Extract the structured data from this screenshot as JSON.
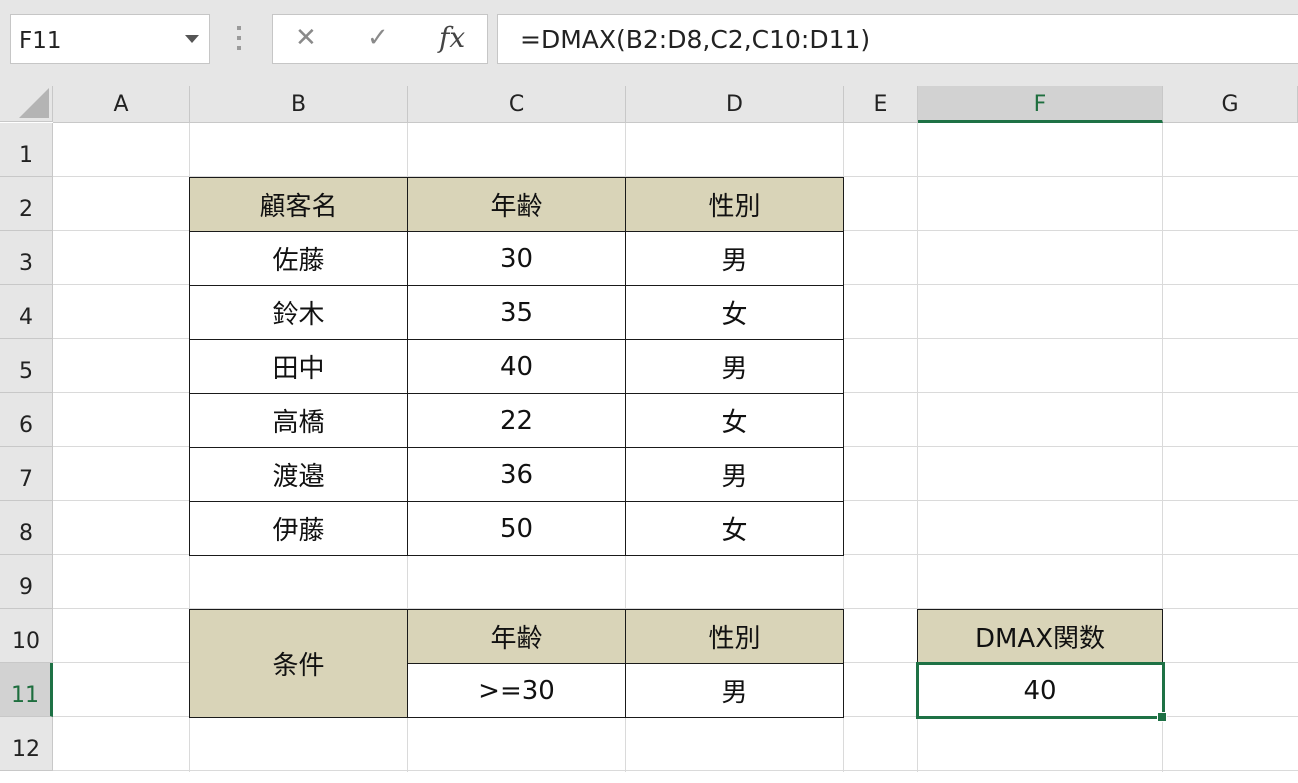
{
  "formula_bar": {
    "name_box": "F11",
    "cancel_symbol": "✕",
    "enter_symbol": "✓",
    "fx_label": "fx",
    "formula": "=DMAX(B2:D8,C2,C10:D11)"
  },
  "columns": [
    "A",
    "B",
    "C",
    "D",
    "E",
    "F",
    "G"
  ],
  "rows": [
    "1",
    "2",
    "3",
    "4",
    "5",
    "6",
    "7",
    "8",
    "9",
    "10",
    "11",
    "12"
  ],
  "selected": {
    "column": "F",
    "row": "11"
  },
  "table": {
    "headers": [
      "顧客名",
      "年齢",
      "性別"
    ],
    "rows": [
      [
        "佐藤",
        "30",
        "男"
      ],
      [
        "鈴木",
        "35",
        "女"
      ],
      [
        "田中",
        "40",
        "男"
      ],
      [
        "高橋",
        "22",
        "女"
      ],
      [
        "渡邉",
        "36",
        "男"
      ],
      [
        "伊藤",
        "50",
        "女"
      ]
    ]
  },
  "criteria": {
    "label": "条件",
    "headers": [
      "年齢",
      "性別"
    ],
    "values": [
      ">=30",
      "男"
    ]
  },
  "result": {
    "header": "DMAX関数",
    "value": "40"
  },
  "colors": {
    "header_fill": "#d9d4b8",
    "selection": "#1e7145"
  }
}
